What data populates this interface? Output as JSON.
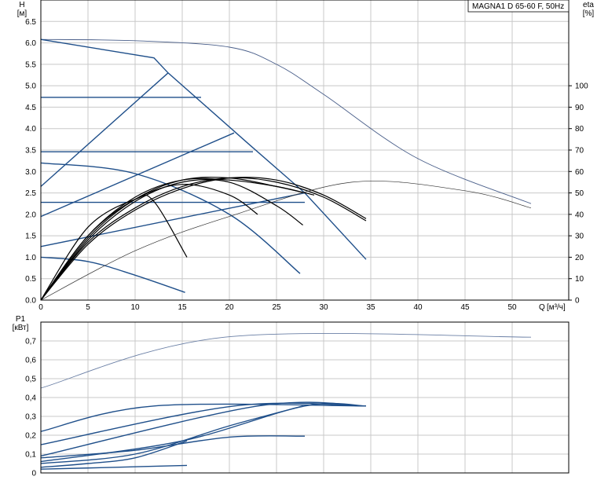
{
  "chart_data": [
    {
      "type": "line",
      "title": "MAGNA1 D 65-60 F, 50Hz",
      "y_label": "H",
      "y_unit": "[м]",
      "x_label": "Q",
      "x_unit": "[м³/ч]",
      "y2_label": "eta",
      "y2_unit": "[%]",
      "xlim": [
        0,
        56
      ],
      "ylim": [
        0,
        7.0
      ],
      "y2lim": [
        0,
        140
      ],
      "x_ticks": [
        "0",
        "5",
        "10",
        "15",
        "20",
        "25",
        "30",
        "35",
        "40",
        "45",
        "50"
      ],
      "y_ticks": [
        "0.0",
        "0.5",
        "1.0",
        "1.5",
        "2.0",
        "2.5",
        "3.0",
        "3.5",
        "4.0",
        "4.5",
        "5.0",
        "5.5",
        "6.0",
        "6.5"
      ],
      "y2_ticks": [
        "0",
        "10",
        "20",
        "30",
        "40",
        "50",
        "60",
        "70",
        "80",
        "90",
        "100"
      ],
      "grid": true,
      "head_curves": [
        {
          "style": "max-speed",
          "x": [
            0,
            10,
            20,
            25,
            30,
            40,
            52
          ],
          "y": [
            6.08,
            6.05,
            5.9,
            5.5,
            4.8,
            3.3,
            2.25
          ]
        },
        {
          "style": "proportional-pressure",
          "x": [
            0,
            12,
            13.5,
            22,
            28,
            34.5
          ],
          "y": [
            6.08,
            5.65,
            5.3,
            3.65,
            2.5,
            0.95
          ]
        },
        {
          "style": "constant-pressure",
          "x": [
            0,
            17
          ],
          "y": [
            4.73,
            4.73
          ]
        },
        {
          "style": "constant-pressure",
          "x": [
            0,
            22.5
          ],
          "y": [
            3.46,
            3.46
          ]
        },
        {
          "style": "constant-pressure",
          "x": [
            0,
            28
          ],
          "y": [
            2.28,
            2.28
          ]
        },
        {
          "style": "control-line",
          "x": [
            0,
            13.5
          ],
          "y": [
            2.65,
            5.3
          ]
        },
        {
          "style": "control-line",
          "x": [
            0,
            20.5
          ],
          "y": [
            1.95,
            3.9
          ]
        },
        {
          "style": "control-line",
          "x": [
            0,
            28
          ],
          "y": [
            1.25,
            2.5
          ]
        },
        {
          "style": "min-speed",
          "x": [
            0,
            10,
            20,
            27.5
          ],
          "y": [
            3.2,
            2.95,
            2.0,
            0.62
          ]
        },
        {
          "style": "min-speed",
          "x": [
            0,
            5,
            10,
            15.3
          ],
          "y": [
            1.0,
            0.9,
            0.58,
            0.18
          ]
        }
      ],
      "efficiency_curves": [
        {
          "x": [
            0,
            5,
            10,
            15,
            20,
            25,
            30,
            34.5
          ],
          "y": [
            0,
            26,
            42,
            52,
            57,
            56,
            49,
            38
          ]
        },
        {
          "x": [
            0,
            5,
            10,
            15,
            20,
            25,
            30,
            34.5
          ],
          "y": [
            0,
            27,
            43,
            53,
            57,
            55,
            48,
            37
          ]
        },
        {
          "x": [
            0,
            5,
            10,
            15,
            20,
            25,
            27.8
          ],
          "y": [
            0,
            28,
            46,
            55,
            55,
            44,
            35
          ]
        },
        {
          "x": [
            0,
            5,
            10,
            15,
            20,
            25,
            29
          ],
          "y": [
            0,
            30,
            48,
            56,
            56,
            53,
            49
          ]
        },
        {
          "x": [
            0,
            5,
            10,
            15,
            20,
            25,
            28
          ],
          "y": [
            0,
            29,
            47,
            56,
            57,
            53,
            50
          ]
        },
        {
          "x": [
            0,
            5,
            10,
            15,
            20,
            23
          ],
          "y": [
            0,
            30,
            47,
            54,
            49,
            40
          ]
        },
        {
          "x": [
            0,
            5,
            10,
            12,
            15.5
          ],
          "y": [
            0,
            34,
            47,
            46,
            20
          ]
        },
        {
          "x": [
            0,
            10,
            20,
            33,
            45,
            52
          ],
          "y": [
            0,
            23,
            39,
            55,
            51,
            43
          ]
        }
      ]
    },
    {
      "type": "line",
      "y_label": "P1",
      "y_unit": "[кВт]",
      "xlim": [
        0,
        56
      ],
      "ylim": [
        0,
        0.8
      ],
      "y_ticks": [
        "0",
        "0,1",
        "0,2",
        "0,3",
        "0,4",
        "0,5",
        "0,6",
        "0,7"
      ],
      "grid": true,
      "power_curves": [
        {
          "style": "max-speed",
          "x": [
            0,
            19.5,
            52
          ],
          "y": [
            0.45,
            0.72,
            0.72
          ]
        },
        {
          "x": [
            0,
            12,
            34.5
          ],
          "y": [
            0.22,
            0.355,
            0.355
          ]
        },
        {
          "x": [
            0,
            20.5,
            34.5
          ],
          "y": [
            0.15,
            0.355,
            0.355
          ]
        },
        {
          "x": [
            0,
            23,
            34.5
          ],
          "y": [
            0.09,
            0.355,
            0.355
          ]
        },
        {
          "x": [
            0,
            15,
            28,
            34.5
          ],
          "y": [
            0.06,
            0.17,
            0.355,
            0.355
          ]
        },
        {
          "x": [
            0,
            10,
            20,
            28
          ],
          "y": [
            0.08,
            0.12,
            0.19,
            0.195
          ]
        },
        {
          "x": [
            0,
            10,
            20,
            27.8
          ],
          "y": [
            0.05,
            0.1,
            0.25,
            0.355
          ]
        },
        {
          "x": [
            0,
            5,
            10,
            15.5
          ],
          "y": [
            0.03,
            0.05,
            0.08,
            0.17
          ]
        },
        {
          "x": [
            0,
            8,
            15.5
          ],
          "y": [
            0.02,
            0.03,
            0.04
          ]
        }
      ]
    }
  ]
}
